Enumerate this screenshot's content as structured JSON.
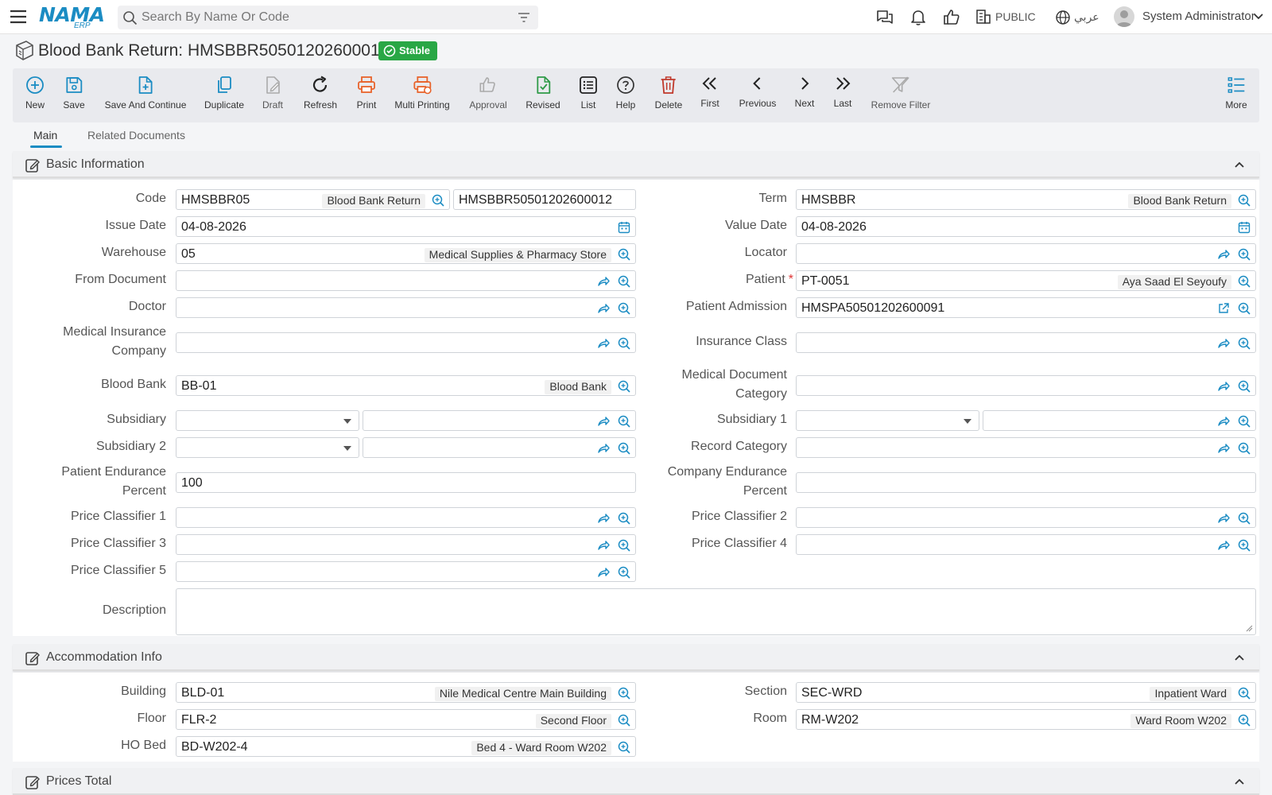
{
  "topbar": {
    "logo_main": "NAMA",
    "logo_sub": "ERP",
    "search_placeholder": "Search By Name Or Code",
    "public_label": "PUBLIC",
    "language_label": "عربي",
    "user_name": "System Administrator"
  },
  "page": {
    "title": "Blood Bank Return: HMSBBR50501202600012",
    "status": "Stable",
    "status_color": "#29a745"
  },
  "toolbar": {
    "new": "New",
    "save": "Save",
    "save_continue": "Save And Continue",
    "duplicate": "Duplicate",
    "draft": "Draft",
    "refresh": "Refresh",
    "print": "Print",
    "multi_printing": "Multi Printing",
    "approval": "Approval",
    "revised": "Revised",
    "list": "List",
    "help": "Help",
    "delete": "Delete",
    "first": "First",
    "previous": "Previous",
    "next": "Next",
    "last": "Last",
    "remove_filter": "Remove Filter",
    "more": "More"
  },
  "tabs": {
    "main": "Main",
    "related": "Related Documents"
  },
  "basic": {
    "title": "Basic Information",
    "code": {
      "label": "Code",
      "value": "HMSBBR05",
      "desc": "Blood Bank Return",
      "number": "HMSBBR50501202600012"
    },
    "term": {
      "label": "Term",
      "value": "HMSBBR",
      "desc": "Blood Bank Return"
    },
    "issue_date": {
      "label": "Issue Date",
      "value": "04-08-2026"
    },
    "value_date": {
      "label": "Value Date",
      "value": "04-08-2026"
    },
    "warehouse": {
      "label": "Warehouse",
      "value": "05",
      "desc": "Medical Supplies & Pharmacy Store"
    },
    "locator": {
      "label": "Locator"
    },
    "from_document": {
      "label": "From Document"
    },
    "patient": {
      "label": "Patient",
      "value": "PT-0051",
      "desc": "Aya Saad El Seyoufy"
    },
    "doctor": {
      "label": "Doctor"
    },
    "patient_admission": {
      "label": "Patient Admission",
      "value": "HMSPA50501202600091"
    },
    "medical_insurance_company": {
      "label1": "Medical Insurance",
      "label2": "Company"
    },
    "insurance_class": {
      "label": "Insurance Class"
    },
    "blood_bank": {
      "label": "Blood Bank",
      "value": "BB-01",
      "desc": "Blood Bank"
    },
    "medical_document_category": {
      "label1": "Medical Document",
      "label2": "Category"
    },
    "subsidiary": {
      "label": "Subsidiary"
    },
    "subsidiary1": {
      "label": "Subsidiary 1"
    },
    "subsidiary2": {
      "label": "Subsidiary 2"
    },
    "record_category": {
      "label": "Record Category"
    },
    "patient_endurance": {
      "label1": "Patient Endurance",
      "label2": "Percent",
      "value": "100"
    },
    "company_endurance": {
      "label1": "Company Endurance",
      "label2": "Percent"
    },
    "price_classifier1": {
      "label": "Price Classifier 1"
    },
    "price_classifier2": {
      "label": "Price Classifier 2"
    },
    "price_classifier3": {
      "label": "Price Classifier 3"
    },
    "price_classifier4": {
      "label": "Price Classifier 4"
    },
    "price_classifier5": {
      "label": "Price Classifier 5"
    },
    "description": {
      "label": "Description"
    }
  },
  "accommodation": {
    "title": "Accommodation Info",
    "building": {
      "label": "Building",
      "value": "BLD-01",
      "desc": "Nile Medical Centre Main Building"
    },
    "section": {
      "label": "Section",
      "value": "SEC-WRD",
      "desc": "Inpatient Ward"
    },
    "floor": {
      "label": "Floor",
      "value": "FLR-2",
      "desc": "Second Floor"
    },
    "room": {
      "label": "Room",
      "value": "RM-W202",
      "desc": "Ward Room W202"
    },
    "ho_bed": {
      "label": "HO Bed",
      "value": "BD-W202-4",
      "desc": "Bed 4 - Ward Room W202"
    }
  },
  "prices_total": {
    "title": "Prices Total"
  },
  "colors": {
    "accent": "#1b8cc3",
    "print": "#e8632b",
    "revised": "#2e9a47",
    "delete": "#c0392b"
  }
}
